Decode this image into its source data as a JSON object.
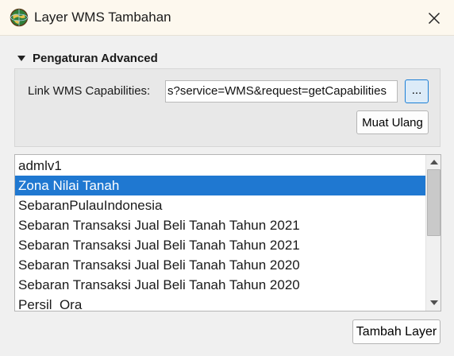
{
  "window": {
    "title": "Layer WMS Tambahan",
    "icon": "globe-app-icon",
    "close_icon": "close-icon"
  },
  "section": {
    "title": "Pengaturan Advanced",
    "expanded_icon": "triangle-down-icon"
  },
  "wms": {
    "label": "Link WMS Capabilities:",
    "url_value": "s?service=WMS&request=getCapabilities",
    "browse_label": "...",
    "reload_label": "Muat Ulang"
  },
  "layers": {
    "items": [
      "admlv1",
      "Zona Nilai Tanah",
      "SebaranPulauIndonesia",
      "Sebaran Transaksi Jual Beli Tanah Tahun 2021",
      "Sebaran Transaksi Jual Beli Tanah Tahun 2021",
      "Sebaran Transaksi Jual Beli Tanah Tahun 2020",
      "Sebaran Transaksi Jual Beli Tanah Tahun 2020",
      "Persil_Ora"
    ],
    "selected_item": "Zona Nilai Tanah"
  },
  "footer": {
    "add_label": "Tambah Layer"
  },
  "colors": {
    "selection": "#1f78d1",
    "accent_border": "#1b7fd6",
    "titlebar": "#fdf8ee"
  }
}
